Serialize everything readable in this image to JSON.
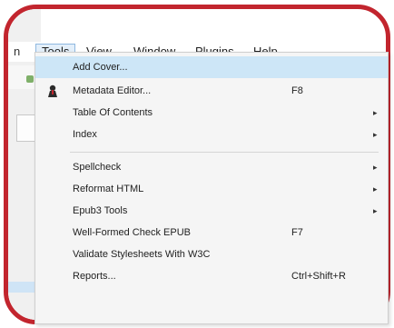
{
  "menubar": {
    "items": [
      {
        "label": "n"
      },
      {
        "label": "Tools"
      },
      {
        "label": "View"
      },
      {
        "label": "Window"
      },
      {
        "label": "Plugins"
      },
      {
        "label": "Help"
      }
    ]
  },
  "tools_menu": {
    "items": [
      {
        "label": "Add Cover...",
        "shortcut": "",
        "submenu": false
      },
      {
        "label": "Metadata Editor...",
        "shortcut": "F8",
        "submenu": false,
        "icon": "metadata-editor-icon"
      },
      {
        "label": "Table Of Contents",
        "shortcut": "",
        "submenu": true
      },
      {
        "label": "Index",
        "shortcut": "",
        "submenu": true
      },
      {
        "label": "Spellcheck",
        "shortcut": "",
        "submenu": true
      },
      {
        "label": "Reformat HTML",
        "shortcut": "",
        "submenu": true
      },
      {
        "label": "Epub3 Tools",
        "shortcut": "",
        "submenu": true
      },
      {
        "label": "Well-Formed Check EPUB",
        "shortcut": "F7",
        "submenu": false
      },
      {
        "label": "Validate Stylesheets With W3C",
        "shortcut": "",
        "submenu": false
      },
      {
        "label": "Reports...",
        "shortcut": "Ctrl+Shift+R",
        "submenu": false
      }
    ],
    "arrow_glyph": "▸"
  },
  "colors": {
    "frame_border": "#c2252e",
    "highlight": "#cde6f7",
    "menu_bg": "#f5f5f5"
  }
}
